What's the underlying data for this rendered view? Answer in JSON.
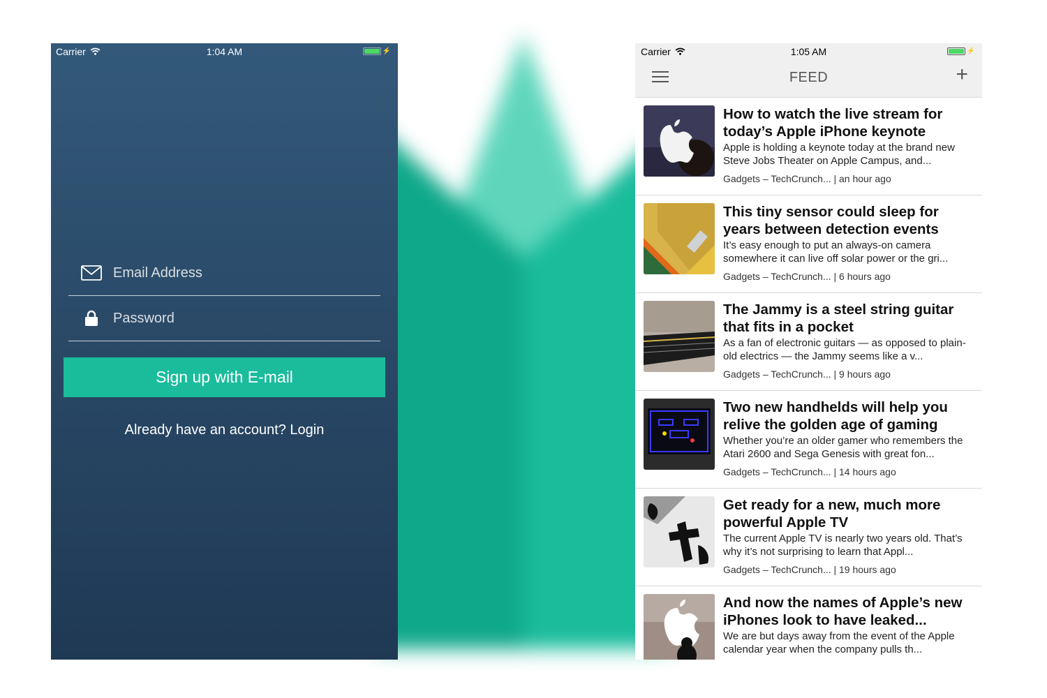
{
  "left_screen": {
    "status": {
      "carrier": "Carrier",
      "time": "1:04 AM"
    },
    "email_placeholder": "Email Address",
    "password_placeholder": "Password",
    "signup_label": "Sign up with E-mail",
    "login_prompt": "Already have an account? Login"
  },
  "right_screen": {
    "status": {
      "carrier": "Carrier",
      "time": "1:05 AM"
    },
    "nav_title": "FEED",
    "add_icon": "plus-icon",
    "menu_icon": "hamburger-icon",
    "items": [
      {
        "title": "How to watch the live stream for today’s Apple iPhone keynote",
        "summary": "Apple is holding a keynote today at the brand new Steve Jobs Theater on Apple Campus, and...",
        "meta": "Gadgets – TechCrunch... | an hour ago"
      },
      {
        "title": "This tiny sensor could sleep for years between detection events",
        "summary": "It’s easy enough to put an always-on camera somewhere it can live off solar power or the gri...",
        "meta": "Gadgets – TechCrunch... | 6 hours ago"
      },
      {
        "title": "The Jammy is a steel string guitar that fits in a pocket",
        "summary": "As a fan of electronic guitars — as opposed to plain-old electrics — the Jammy seems like a v...",
        "meta": "Gadgets – TechCrunch... | 9 hours ago"
      },
      {
        "title": "Two new handhelds will help you relive the golden age of gaming",
        "summary": "Whether you’re an older gamer who remembers the Atari 2600 and Sega Genesis with great fon...",
        "meta": "Gadgets – TechCrunch... | 14 hours ago"
      },
      {
        "title": "Get ready for a new, much more powerful Apple TV",
        "summary": "The current Apple TV is nearly two years old. That’s why it’s not surprising to learn that Appl...",
        "meta": "Gadgets – TechCrunch... | 19 hours ago"
      },
      {
        "title": "And now the names of Apple’s new iPhones look to have leaked...",
        "summary": "We are but days away from the event of the Apple calendar year when the company pulls th...",
        "meta": ""
      }
    ]
  },
  "colors": {
    "accent": "#1abc9c",
    "left_bg_top": "#33597a",
    "left_bg_bottom": "#1f3954",
    "battery": "#4cd964"
  }
}
